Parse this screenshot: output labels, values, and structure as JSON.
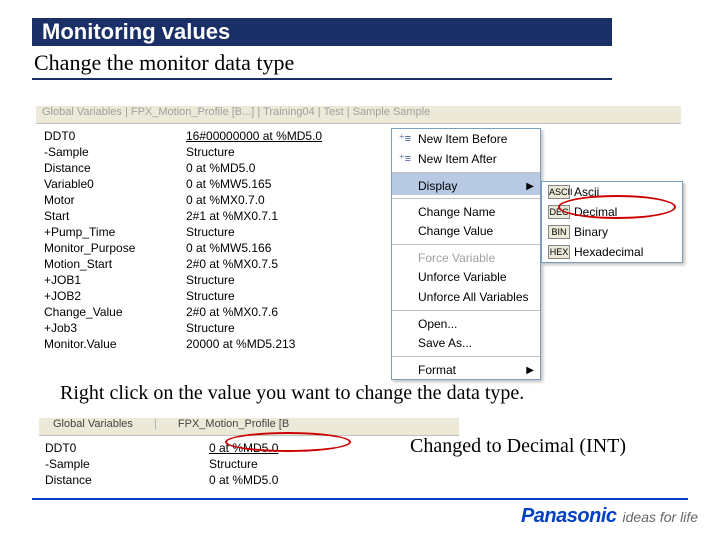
{
  "title": "Monitoring values",
  "subtitle": "Change the monitor data type",
  "app_main": {
    "toolbar_preview": "Global Variables    |    FPX_Motion_Profile [B...]    |    Training04    |    Test    |    Sample          Sample",
    "rows": [
      {
        "name": "DDT0",
        "val": "16#00000000 at %MD5.0",
        "under": true
      },
      {
        "name": "-Sample",
        "val": "Structure"
      },
      {
        "name": " Distance",
        "val": "0 at %MD5.0"
      },
      {
        "name": " Variable0",
        "val": "0 at %MW5.165"
      },
      {
        "name": " Motor",
        "val": "0 at %MX0.7.0"
      },
      {
        "name": " Start",
        "val": "2#1 at %MX0.7.1"
      },
      {
        "name": " +Pump_Time",
        "val": "Structure"
      },
      {
        "name": " Monitor_Purpose",
        "val": "0 at %MW5.166"
      },
      {
        "name": " Motion_Start",
        "val": "2#0 at %MX0.7.5"
      },
      {
        "name": " +JOB1",
        "val": "Structure"
      },
      {
        "name": " +JOB2",
        "val": "Structure"
      },
      {
        "name": " Change_Value",
        "val": "2#0 at %MX0.7.6"
      },
      {
        "name": " +Job3",
        "val": "Structure"
      },
      {
        "name": " Monitor.Value",
        "val": "20000 at %MD5.213"
      }
    ]
  },
  "menu": [
    {
      "label": "New Item Before",
      "icon": "⁺≡"
    },
    {
      "label": "New Item After",
      "icon": "⁺≡"
    },
    {
      "label": "Display",
      "hl": true,
      "sep": true,
      "arrow": true
    },
    {
      "label": "Change Name",
      "sep": true
    },
    {
      "label": "Change Value"
    },
    {
      "label": "Force Variable",
      "sep": true,
      "dis": true
    },
    {
      "label": "Unforce Variable"
    },
    {
      "label": "Unforce All Variables"
    },
    {
      "label": "Open...",
      "sep": true
    },
    {
      "label": "Save As..."
    },
    {
      "label": "Format",
      "sep": true,
      "arrow": true
    }
  ],
  "submenu": [
    {
      "abbr": "ASCII",
      "label": "Ascii"
    },
    {
      "abbr": "DEC",
      "label": "Decimal"
    },
    {
      "abbr": "BIN",
      "label": "Binary"
    },
    {
      "abbr": "HEX",
      "label": "Hexadecimal"
    }
  ],
  "caption_main": "Right click on the value you want to change the data type.",
  "app_second": {
    "tab1": "Global Variables",
    "tab2": "FPX_Motion_Profile [B",
    "rows": [
      {
        "name": "DDT0",
        "val": "0 at %MD5.0",
        "under": true
      },
      {
        "name": "-Sample",
        "val": "Structure"
      },
      {
        "name": " Distance",
        "val": "0 at %MD5.0"
      }
    ]
  },
  "note_second": "Changed to Decimal (INT)",
  "logo": {
    "brand": "Panasonic",
    "tag": "ideas for life"
  }
}
